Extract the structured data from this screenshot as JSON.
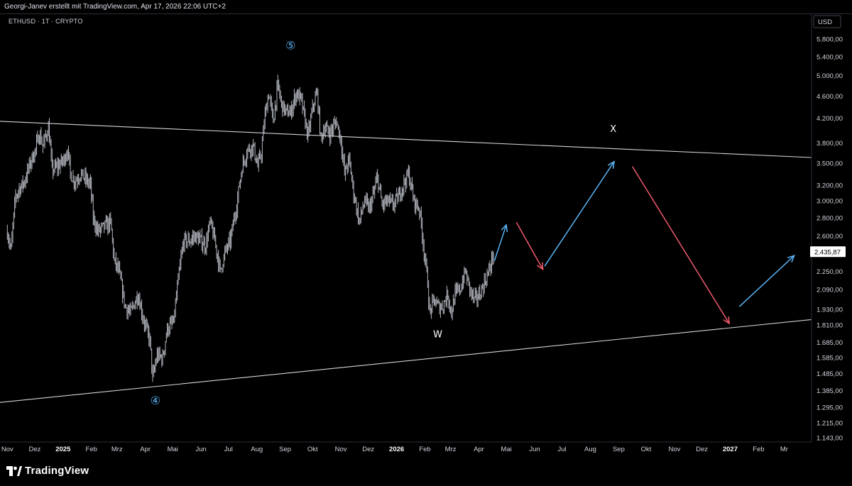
{
  "header": {
    "caption": "Georgi-Janev erstellt mit TradingView.com, Apr 17, 2026 22:06 UTC+2"
  },
  "chart_data": {
    "type": "candlestick",
    "symbol_label": "ETHUSD · 1T · CRYPTO",
    "currency": "USD",
    "y_scale": "log",
    "ylim": [
      1143,
      6200
    ],
    "y_ticks": [
      "5.800,00",
      "5.400,00",
      "5.000,00",
      "4.600,00",
      "4.200,00",
      "3.800,00",
      "3.500,00",
      "3.200,00",
      "3.000,00",
      "2.800,00",
      "2.600,00",
      "2.250,00",
      "2.090,00",
      "1.930,00",
      "1.810,00",
      "1.685,00",
      "1.585,00",
      "1.485,00",
      "1.385,00",
      "1.295,00",
      "1.215,00",
      "1.143,00"
    ],
    "x_ticks": [
      {
        "label": "Nov",
        "bold": false
      },
      {
        "label": "Dez",
        "bold": false
      },
      {
        "label": "2025",
        "bold": true
      },
      {
        "label": "Feb",
        "bold": false
      },
      {
        "label": "Mrz",
        "bold": false
      },
      {
        "label": "Apr",
        "bold": false
      },
      {
        "label": "Mai",
        "bold": false
      },
      {
        "label": "Jun",
        "bold": false
      },
      {
        "label": "Jul",
        "bold": false
      },
      {
        "label": "Aug",
        "bold": false
      },
      {
        "label": "Sep",
        "bold": false
      },
      {
        "label": "Okt",
        "bold": false
      },
      {
        "label": "Nov",
        "bold": false
      },
      {
        "label": "Dez",
        "bold": false
      },
      {
        "label": "2026",
        "bold": true
      },
      {
        "label": "Feb",
        "bold": false
      },
      {
        "label": "Mrz",
        "bold": false
      },
      {
        "label": "Apr",
        "bold": false
      },
      {
        "label": "Mai",
        "bold": false
      },
      {
        "label": "Jun",
        "bold": false
      },
      {
        "label": "Jul",
        "bold": false
      },
      {
        "label": "Aug",
        "bold": false
      },
      {
        "label": "Sep",
        "bold": false
      },
      {
        "label": "Okt",
        "bold": false
      },
      {
        "label": "Nov",
        "bold": false
      },
      {
        "label": "Dez",
        "bold": false
      },
      {
        "label": "2027",
        "bold": true
      },
      {
        "label": "Feb",
        "bold": false
      },
      {
        "label": "Mr",
        "bold": false
      }
    ],
    "last_price_label": "2.435,87",
    "price_path": [
      [
        "2024-11-01",
        2650
      ],
      [
        "2024-11-05",
        2450
      ],
      [
        "2024-11-10",
        3050
      ],
      [
        "2024-11-14",
        3150
      ],
      [
        "2024-11-20",
        3250
      ],
      [
        "2024-11-26",
        3500
      ],
      [
        "2024-12-02",
        3700
      ],
      [
        "2024-12-06",
        3950
      ],
      [
        "2024-12-10",
        3750
      ],
      [
        "2024-12-16",
        4050
      ],
      [
        "2024-12-20",
        3400
      ],
      [
        "2024-12-26",
        3450
      ],
      [
        "2025-01-02",
        3550
      ],
      [
        "2025-01-06",
        3700
      ],
      [
        "2025-01-09",
        3350
      ],
      [
        "2025-01-14",
        3250
      ],
      [
        "2025-01-20",
        3350
      ],
      [
        "2025-01-24",
        3300
      ],
      [
        "2025-01-31",
        3200
      ],
      [
        "2025-02-03",
        2800
      ],
      [
        "2025-02-08",
        2650
      ],
      [
        "2025-02-15",
        2700
      ],
      [
        "2025-02-22",
        2750
      ],
      [
        "2025-02-26",
        2350
      ],
      [
        "2025-03-03",
        2250
      ],
      [
        "2025-03-10",
        1950
      ],
      [
        "2025-03-16",
        1900
      ],
      [
        "2025-03-24",
        2050
      ],
      [
        "2025-03-30",
        1850
      ],
      [
        "2025-04-06",
        1700
      ],
      [
        "2025-04-09",
        1450
      ],
      [
        "2025-04-14",
        1600
      ],
      [
        "2025-04-20",
        1580
      ],
      [
        "2025-04-25",
        1780
      ],
      [
        "2025-05-02",
        1830
      ],
      [
        "2025-05-09",
        2300
      ],
      [
        "2025-05-13",
        2550
      ],
      [
        "2025-05-20",
        2550
      ],
      [
        "2025-05-25",
        2600
      ],
      [
        "2025-06-01",
        2550
      ],
      [
        "2025-06-06",
        2500
      ],
      [
        "2025-06-11",
        2750
      ],
      [
        "2025-06-16",
        2550
      ],
      [
        "2025-06-22",
        2250
      ],
      [
        "2025-06-28",
        2450
      ],
      [
        "2025-07-03",
        2550
      ],
      [
        "2025-07-10",
        2950
      ],
      [
        "2025-07-16",
        3450
      ],
      [
        "2025-07-22",
        3700
      ],
      [
        "2025-07-28",
        3750
      ],
      [
        "2025-08-02",
        3450
      ],
      [
        "2025-08-06",
        3650
      ],
      [
        "2025-08-10",
        4250
      ],
      [
        "2025-08-14",
        4650
      ],
      [
        "2025-08-19",
        4150
      ],
      [
        "2025-08-24",
        4800
      ],
      [
        "2025-08-28",
        4450
      ],
      [
        "2025-09-02",
        4300
      ],
      [
        "2025-09-07",
        4300
      ],
      [
        "2025-09-13",
        4650
      ],
      [
        "2025-09-18",
        4550
      ],
      [
        "2025-09-23",
        4150
      ],
      [
        "2025-09-26",
        3900
      ],
      [
        "2025-10-02",
        4450
      ],
      [
        "2025-10-06",
        4650
      ],
      [
        "2025-10-10",
        3850
      ],
      [
        "2025-10-14",
        4050
      ],
      [
        "2025-10-20",
        3950
      ],
      [
        "2025-10-27",
        4150
      ],
      [
        "2025-11-01",
        3850
      ],
      [
        "2025-11-05",
        3350
      ],
      [
        "2025-11-10",
        3550
      ],
      [
        "2025-11-15",
        3100
      ],
      [
        "2025-11-21",
        2750
      ],
      [
        "2025-11-27",
        3000
      ],
      [
        "2025-12-02",
        2900
      ],
      [
        "2025-12-06",
        3050
      ],
      [
        "2025-12-11",
        3300
      ],
      [
        "2025-12-16",
        2950
      ],
      [
        "2025-12-22",
        3000
      ],
      [
        "2025-12-28",
        2950
      ],
      [
        "2026-01-03",
        3050
      ],
      [
        "2026-01-08",
        3200
      ],
      [
        "2026-01-14",
        3350
      ],
      [
        "2026-01-20",
        3000
      ],
      [
        "2026-01-26",
        2900
      ],
      [
        "2026-01-31",
        2450
      ],
      [
        "2026-02-04",
        2150
      ],
      [
        "2026-02-06",
        1900
      ],
      [
        "2026-02-11",
        2000
      ],
      [
        "2026-02-16",
        1950
      ],
      [
        "2026-02-20",
        1950
      ],
      [
        "2026-02-26",
        2050
      ],
      [
        "2026-03-02",
        1900
      ],
      [
        "2026-03-06",
        2050
      ],
      [
        "2026-03-12",
        2100
      ],
      [
        "2026-03-17",
        2250
      ],
      [
        "2026-03-22",
        2100
      ],
      [
        "2026-03-27",
        2000
      ],
      [
        "2026-04-02",
        2050
      ],
      [
        "2026-04-07",
        2150
      ],
      [
        "2026-04-12",
        2250
      ],
      [
        "2026-04-17",
        2436
      ]
    ],
    "trendlines": [
      {
        "name": "upper-resistance",
        "from": [
          "2024-10-24",
          4150
        ],
        "to": [
          "2027-03-31",
          3580
        ]
      },
      {
        "name": "lower-support",
        "from": [
          "2024-10-24",
          1320
        ],
        "to": [
          "2027-03-31",
          1850
        ]
      }
    ],
    "projection_arrows": [
      {
        "color": "#5ab4f5",
        "from": [
          "2026-04-18",
          2350
        ],
        "to": [
          "2026-05-01",
          2720
        ]
      },
      {
        "color": "#f0596d",
        "from": [
          "2026-05-12",
          2750
        ],
        "to": [
          "2026-06-10",
          2270
        ]
      },
      {
        "color": "#5ab4f5",
        "from": [
          "2026-06-12",
          2300
        ],
        "to": [
          "2026-08-27",
          3520
        ]
      },
      {
        "color": "#f0596d",
        "from": [
          "2026-09-16",
          3450
        ],
        "to": [
          "2026-12-31",
          1820
        ]
      },
      {
        "color": "#5ab4f5",
        "from": [
          "2027-01-11",
          1950
        ],
        "to": [
          "2027-03-12",
          2400
        ]
      }
    ],
    "annotations": [
      {
        "text": "⑤",
        "date": "2025-09-07",
        "price": 5560,
        "color": "#5ab4f5"
      },
      {
        "text": "④",
        "date": "2025-04-12",
        "price": 1310,
        "color": "#5ab4f5"
      },
      {
        "text": "W",
        "date": "2026-02-15",
        "price": 1720,
        "color": "#ffffff"
      },
      {
        "text": "X",
        "date": "2026-08-26",
        "price": 3970,
        "color": "#ffffff"
      }
    ],
    "colors": {
      "candles": "#b2b5be",
      "trendlines": "#d1d4dc",
      "blue": "#5ab4f5",
      "red": "#f0596d"
    },
    "grid": false
  },
  "footer": {
    "brand": "TradingView"
  }
}
